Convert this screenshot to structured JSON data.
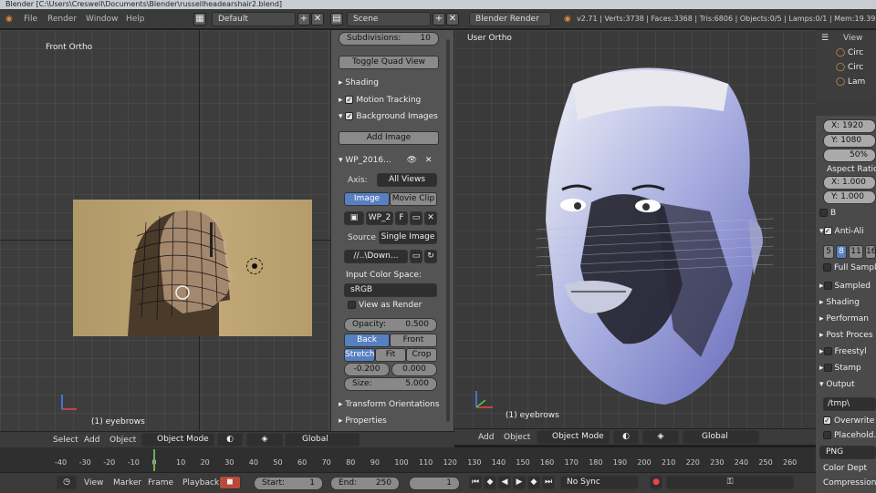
{
  "window_title": "Blender  [C:\\Users\\Creswell\\Documents\\Blender\\russellheadearshair2.blend]",
  "topbar": {
    "menus": [
      "File",
      "Render",
      "Window",
      "Help"
    ],
    "layout": "Default",
    "scene": "Scene",
    "engine": "Blender Render",
    "stats": "v2.71 | Verts:3738 | Faces:3368 | Tris:6806 | Objects:0/5 | Lamps:0/1 | Mem:19.39"
  },
  "left_view": {
    "label": "Front Ortho",
    "object": "(1) eyebrows"
  },
  "right_view": {
    "label": "User Ortho",
    "object": "(1) eyebrows"
  },
  "npanel": {
    "subdivisions_label": "Subdivisions:",
    "subdivisions_value": "10",
    "toggle_quad": "Toggle Quad View",
    "shading": "Shading",
    "motion_tracking": "Motion Tracking",
    "background_images": "Background Images",
    "add_image": "Add Image",
    "image_name": "WP_2016...",
    "axis_label": "Axis:",
    "axis_value": "All Views",
    "tab_image": "Image",
    "tab_movieclip": "Movie Clip",
    "datablock": "WP_2",
    "datablock_f": "F",
    "source_label": "Source",
    "source_value": "Single Image",
    "filepath": "//..\\Down...",
    "input_color_space": "Input Color Space:",
    "color_space_value": "sRGB",
    "view_as_render": "View as Render",
    "opacity_label": "Opacity:",
    "opacity_value": "0.500",
    "back": "Back",
    "front": "Front",
    "stretch": "Stretch",
    "fit": "Fit",
    "crop": "Crop",
    "offset_x": "-0.200",
    "offset_y": "0.000",
    "size_label": "Size:",
    "size_value": "5.000",
    "transform_orientations": "Transform Orientations",
    "properties": "Properties"
  },
  "outliner": {
    "items": [
      "View",
      "Circ",
      "Circ",
      "Lam"
    ]
  },
  "properties": {
    "res_x": "X: 1920 px",
    "res_y": "Y: 1080 px",
    "percent": "50%",
    "aspect_label": "Aspect Ratio:",
    "aspect_x": "X:   1.000",
    "aspect_y": "Y:   1.000",
    "b": "B",
    "anti_alias": "Anti-Ali",
    "aa_values": [
      "5",
      "8",
      "11",
      "16"
    ],
    "full_sample": "Full Sampl",
    "sampled": "Sampled",
    "shading": "Shading",
    "performance": "Performan",
    "post_processing": "Post Proces",
    "freestyle": "Freestyl",
    "stamp": "Stamp",
    "output": "Output",
    "output_path": "/tmp\\",
    "overwrite": "Overwrite",
    "placeholders": "Placehold...",
    "format": "PNG",
    "color_depth": "Color Dept",
    "compression": "Compression"
  },
  "bottom_left": {
    "select": "Select",
    "add": "Add",
    "object": "Object",
    "mode": "Object Mode",
    "orientation": "Global"
  },
  "bottom_right": {
    "add": "Add",
    "object": "Object",
    "mode": "Object Mode",
    "orientation": "Global"
  },
  "timeline": {
    "ruler": [
      "-40",
      "-30",
      "-20",
      "-10",
      "0",
      "10",
      "20",
      "30",
      "40",
      "50",
      "60",
      "70",
      "80",
      "90",
      "100",
      "110",
      "120",
      "130",
      "140",
      "150",
      "160",
      "170",
      "180",
      "190",
      "200",
      "210",
      "220",
      "230",
      "240",
      "250",
      "260"
    ],
    "view": "View",
    "marker": "Marker",
    "frame": "Frame",
    "playback": "Playback",
    "start": "Start:",
    "start_value": "1",
    "end": "End:",
    "end_value": "250",
    "current": "1",
    "sync": "No Sync"
  }
}
